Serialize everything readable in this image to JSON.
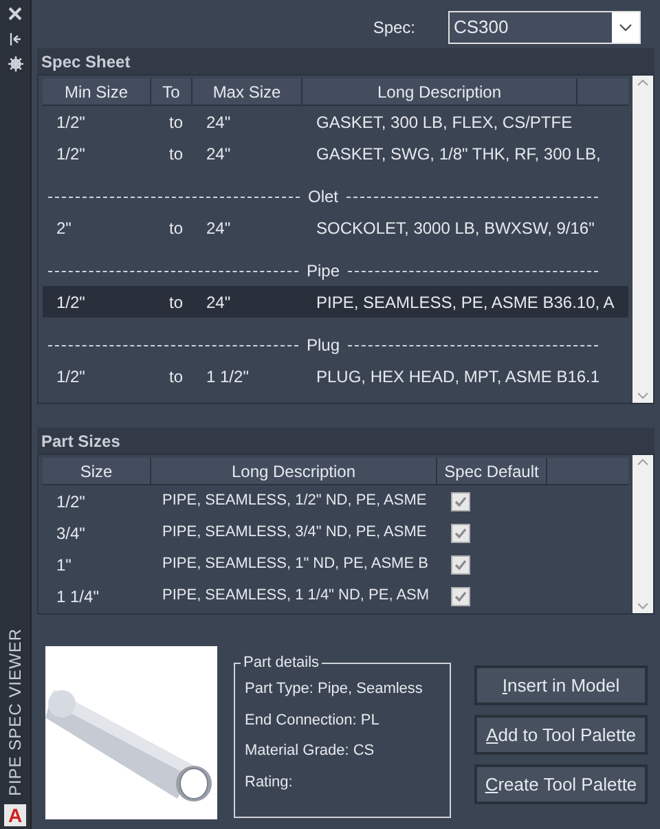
{
  "sidebar": {
    "title": "PIPE SPEC VIEWER",
    "badge": "A"
  },
  "spec": {
    "label": "Spec:",
    "value": "CS300"
  },
  "spec_sheet": {
    "title": "Spec Sheet",
    "columns": [
      "Min Size",
      "To",
      "Max Size",
      "Long Description"
    ],
    "rows": [
      {
        "kind": "part",
        "min": "1/2\"",
        "to": "to",
        "max": "24\"",
        "description": "GASKET, 300 LB, FLEX, CS/PTFE",
        "selected": false
      },
      {
        "kind": "part",
        "min": "1/2\"",
        "to": "to",
        "max": "24\"",
        "description": "GASKET, SWG, 1/8\" THK, RF, 300 LB,",
        "selected": false
      },
      {
        "kind": "group",
        "label": "Olet",
        "selected": false
      },
      {
        "kind": "part",
        "min": "2\"",
        "to": "to",
        "max": "24\"",
        "description": "SOCKOLET, 3000 LB, BWXSW, 9/16\"",
        "selected": false
      },
      {
        "kind": "group",
        "label": "Pipe",
        "selected": false
      },
      {
        "kind": "part",
        "min": "1/2\"",
        "to": "to",
        "max": "24\"",
        "description": "PIPE, SEAMLESS, PE, ASME B36.10, A",
        "selected": true
      },
      {
        "kind": "group",
        "label": "Plug",
        "selected": false
      },
      {
        "kind": "part",
        "min": "1/2\"",
        "to": "to",
        "max": "1 1/2\"",
        "description": "PLUG, HEX HEAD, MPT, ASME B16.1",
        "selected": false
      }
    ]
  },
  "part_sizes": {
    "title": "Part Sizes",
    "columns": [
      "Size",
      "Long Description",
      "Spec Default"
    ],
    "rows": [
      {
        "size": "1/2\"",
        "description": "PIPE, SEAMLESS, 1/2\" ND, PE, ASME",
        "checked": true
      },
      {
        "size": "3/4\"",
        "description": "PIPE, SEAMLESS, 3/4\" ND, PE, ASME",
        "checked": true
      },
      {
        "size": "1\"",
        "description": "PIPE, SEAMLESS, 1\" ND, PE, ASME B",
        "checked": true
      },
      {
        "size": "1 1/4\"",
        "description": "PIPE, SEAMLESS, 1 1/4\" ND, PE, ASM",
        "checked": true
      }
    ]
  },
  "part_details": {
    "title": "Part details",
    "lines": [
      "Part Type: Pipe, Seamless",
      "End Connection: PL",
      "Material Grade: CS",
      "Rating:"
    ]
  },
  "buttons": [
    {
      "label": "Insert in Model"
    },
    {
      "label": "Add to Tool Palette"
    },
    {
      "label": "Create Tool Palette"
    }
  ]
}
